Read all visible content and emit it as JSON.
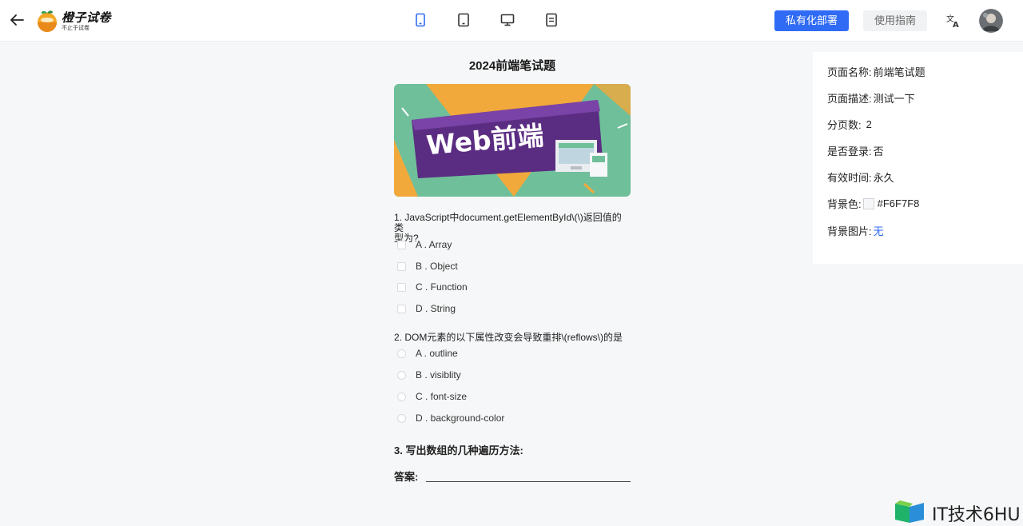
{
  "header": {
    "logo_title": "橙子试卷",
    "logo_subtitle": "不止于试卷",
    "device_buttons": [
      "mobile-icon",
      "tablet-icon",
      "desktop-icon",
      "page-icon"
    ],
    "private_deploy_label": "私有化部署",
    "guide_label": "使用指南"
  },
  "paper": {
    "title": "2024前端笔试题",
    "banner_text": "Web前端",
    "questions": [
      {
        "title_line1": "1. JavaScript中document.getElementById\\(\\)返回值的类",
        "title_line2": "型为?",
        "options": [
          "A . Array",
          "B . Object",
          "C . Function",
          "D . String"
        ]
      },
      {
        "title": "2. DOM元素的以下属性改变会导致重排\\(reflows\\)的是",
        "options": [
          "A . outline",
          "B . visiblity",
          "C . font-size",
          "D . background-color"
        ]
      },
      {
        "title": "3. 写出数组的几种遍历方法:",
        "answer_label": "答案:"
      }
    ]
  },
  "settings": {
    "page_name_label": "页面名称:",
    "page_name": "前端笔试题",
    "page_desc_label": "页面描述:",
    "page_desc": "测试一下",
    "page_count_label": "分页数:",
    "page_count": "2",
    "login_label": "是否登录:",
    "login": "否",
    "valid_label": "有效时间:",
    "valid": "永久",
    "bg_color_label": "背景色:",
    "bg_color": "#F6F7F8",
    "bg_image_label": "背景图片:",
    "bg_image": "无"
  },
  "watermark": "IT技术6HU",
  "colors": {
    "accent": "#2f6bf5",
    "page_bg": "#F6F7F8",
    "banner_green": "#6fbf9a",
    "banner_purple": "#5b2d82",
    "banner_orange": "#f2a93b"
  }
}
